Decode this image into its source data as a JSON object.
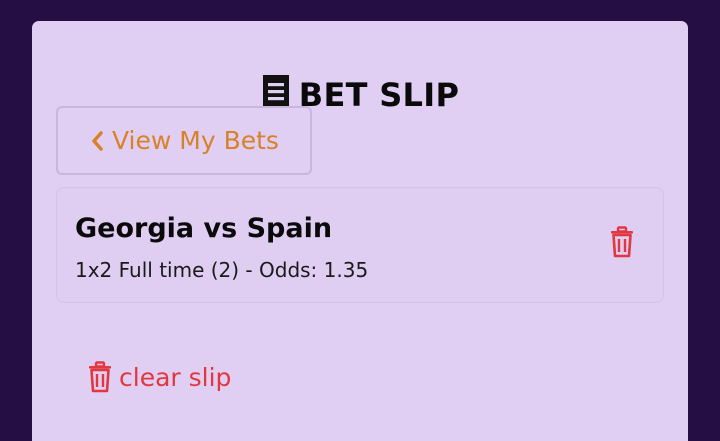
{
  "header": {
    "icon": "receipt-icon",
    "title": "BET SLIP"
  },
  "view_bets": {
    "icon": "chevron-left-icon",
    "label": "View My Bets"
  },
  "bets": [
    {
      "match": "Georgia vs Spain",
      "detail": "1x2 Full time (2) - Odds: 1.35",
      "delete_icon": "trash-icon"
    }
  ],
  "clear_slip": {
    "icon": "trash-icon",
    "label": "clear slip"
  },
  "colors": {
    "background": "#250e44",
    "panel": "#e1cff3",
    "accent_orange": "#d6822a",
    "danger_red": "#e2373f"
  }
}
